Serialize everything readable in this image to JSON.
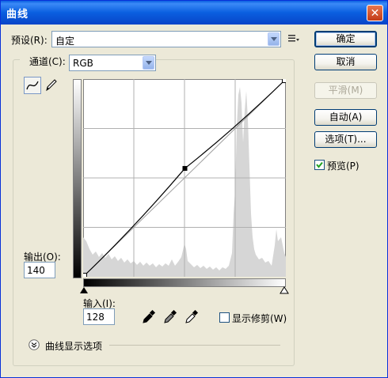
{
  "window": {
    "title": "曲线"
  },
  "preset": {
    "label": "预设(R):",
    "value": "自定"
  },
  "channel": {
    "label": "通道(C):",
    "value": "RGB"
  },
  "buttons": {
    "ok": "确定",
    "cancel": "取消",
    "smooth": "平滑(M)",
    "auto": "自动(A)",
    "options": "选项(T)..."
  },
  "preview": {
    "label": "预览(P)",
    "checked": true
  },
  "output": {
    "label": "输出(O):",
    "value": "140"
  },
  "input": {
    "label": "输入(I):",
    "value": "128"
  },
  "show_clipping": {
    "label": "显示修剪(W)",
    "checked": false
  },
  "curve_options": {
    "label": "曲线显示选项"
  },
  "curve": {
    "points": [
      [
        0,
        0
      ],
      [
        128,
        140
      ],
      [
        255,
        255
      ]
    ]
  },
  "icons": [
    "close-icon",
    "preset-menu-icon",
    "curve-tool-icon",
    "pencil-icon",
    "black-point-eyedropper-icon",
    "gray-point-eyedropper-icon",
    "white-point-eyedropper-icon",
    "expand-chevron-icon",
    "black-slider-icon",
    "white-slider-icon"
  ]
}
